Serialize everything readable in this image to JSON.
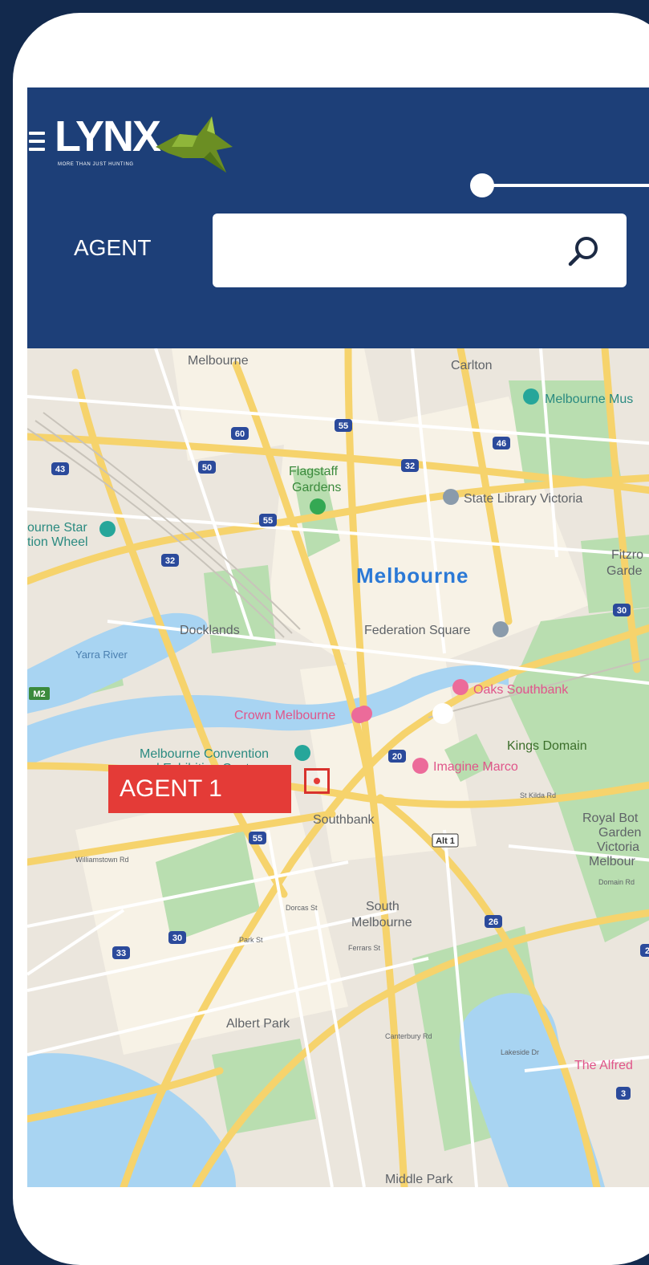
{
  "app": {
    "logo_text": "LYNX",
    "logo_tagline": "MORE THAN JUST HUNTING"
  },
  "header": {
    "agent_label": "AGENT",
    "search": {
      "value": "",
      "placeholder": ""
    }
  },
  "map": {
    "city_label": "Melbourne",
    "labels": {
      "melbourne_north": "Melbourne",
      "carlton": "Carlton",
      "melbourne_museum": "Melbourne Mus",
      "flagstaff_1": "Flagstaff",
      "flagstaff_2": "Gardens",
      "state_library": "State Library Victoria",
      "star_wheel_1": "ourne Star",
      "star_wheel_2": "tion Wheel",
      "fitzroy_1": "Fitzro",
      "fitzroy_2": "Garde",
      "docklands": "Docklands",
      "federation_square": "Federation Square",
      "yarra_river": "Yarra River",
      "oaks_southbank": "Oaks Southbank",
      "crown_melbourne": "Crown Melbourne",
      "kings_domain": "Kings Domain",
      "convention_1": "Melbourne Convention",
      "convention_2": "and Exhibition Centre",
      "imagine_marco": "Imagine Marco",
      "southbank": "Southbank",
      "royal_bot_1": "Royal Bot",
      "royal_bot_2": "Garden",
      "royal_bot_3": "Victoria",
      "royal_bot_4": "Melbour",
      "south_melbourne_1": "South",
      "south_melbourne_2": "Melbourne",
      "albert_park": "Albert Park",
      "the_alfred": "The Alfred",
      "middle_park": "Middle Park",
      "williamstown_rd": "Williamstown Rd",
      "dorcas_st": "Dorcas St",
      "park_st": "Park St",
      "ferrars_st": "Ferrars St",
      "kings_way": "St Kilda Rd",
      "domain_rd": "Domain Rd",
      "canterbury_rd": "Canterbury Rd",
      "lakeside_dr": "Lakeside Dr"
    },
    "shields": {
      "s43": "43",
      "s60a": "60",
      "s50": "50",
      "s55a": "55",
      "s46": "46",
      "s32a": "32",
      "s32b": "32",
      "s55b": "55",
      "s20": "20",
      "s55c": "55",
      "s30a": "30",
      "s33": "33",
      "s26": "26",
      "s3": "3",
      "m2": "M2",
      "alt1": "Alt 1",
      "s30b": "30",
      "s2": "2"
    },
    "agent_tag": "AGENT 1"
  }
}
